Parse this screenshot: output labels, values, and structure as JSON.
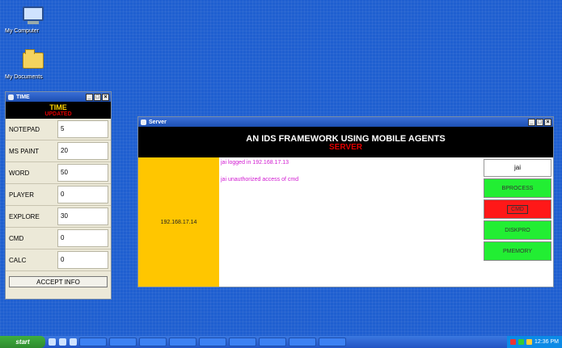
{
  "desktop": {
    "icons": [
      {
        "label": "My Computer",
        "icon": "my-computer-icon"
      },
      {
        "label": "My Documents",
        "icon": "folder-icon"
      }
    ]
  },
  "time_window": {
    "title": "TIME",
    "header": "TIME",
    "subheader": "UPDATED",
    "rows": [
      {
        "label": "NOTEPAD",
        "value": "5"
      },
      {
        "label": "MS PAINT",
        "value": "20"
      },
      {
        "label": "WORD",
        "value": "50"
      },
      {
        "label": "PLAYER",
        "value": "0"
      },
      {
        "label": "EXPLORE",
        "value": "30"
      },
      {
        "label": "CMD",
        "value": "0"
      },
      {
        "label": "CALC",
        "value": "0"
      }
    ],
    "accept_label": "ACCEPT INFO"
  },
  "server_window": {
    "title": "Server",
    "heading": "AN IDS FRAMEWORK USING MOBILE AGENTS",
    "subheading": "SERVER",
    "ip_address": "192.168.17.14",
    "log": [
      "jai logged in 192.168.17.13",
      "jai unauthorized access of cmd"
    ],
    "user": "jai",
    "buttons": [
      "BPROCESS",
      "CMD",
      "DISKPRO",
      "PMEMORY"
    ]
  },
  "taskbar": {
    "start_label": "start",
    "clock": "12:36 PM"
  }
}
